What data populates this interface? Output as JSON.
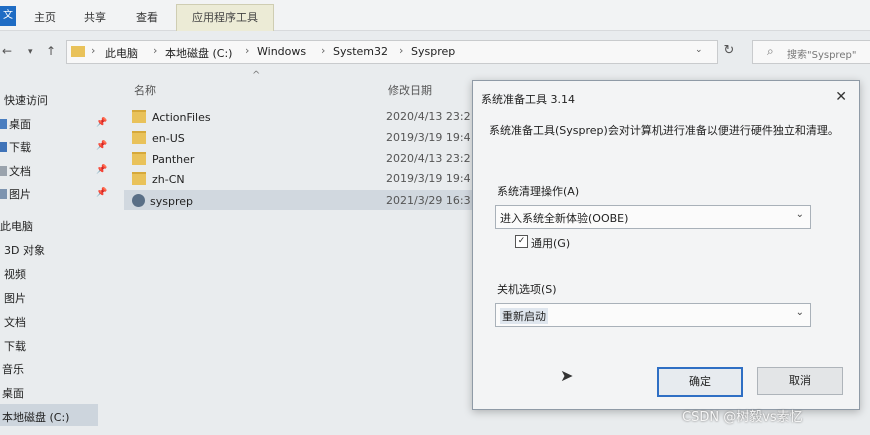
{
  "ribbon": {
    "file_label": "文",
    "tabs": [
      "主页",
      "共享",
      "查看"
    ],
    "context_tab": "应用程序工具"
  },
  "address": {
    "crumbs": [
      "此电脑",
      "本地磁盘 (C:)",
      "Windows",
      "System32",
      "Sysprep"
    ],
    "search_placeholder": "搜索\"Sysprep\""
  },
  "sidebar": {
    "items": [
      "快速访问",
      "桌面",
      "下载",
      "文档",
      "图片",
      "此电脑",
      "3D 对象",
      "视频",
      "图片",
      "文档",
      "下载",
      "音乐",
      "桌面",
      "本地磁盘 (C:)"
    ]
  },
  "columns": {
    "name": "名称",
    "modified": "修改日期"
  },
  "files": [
    {
      "name": "ActionFiles",
      "date": "2020/4/13 23:2",
      "type": "folder"
    },
    {
      "name": "en-US",
      "date": "2019/3/19 19:4",
      "type": "folder"
    },
    {
      "name": "Panther",
      "date": "2020/4/13 23:2",
      "type": "folder"
    },
    {
      "name": "zh-CN",
      "date": "2019/3/19 19:4",
      "type": "folder"
    },
    {
      "name": "sysprep",
      "date": "2021/3/29 16:3",
      "type": "app"
    }
  ],
  "dialog": {
    "title": "系统准备工具 3.14",
    "description": "系统准备工具(Sysprep)会对计算机进行准备以便进行硬件独立和清理。",
    "cleanup_label": "系统清理操作(A)",
    "cleanup_value": "进入系统全新体验(OOBE)",
    "generalize_label": "通用(G)",
    "generalize_checked": true,
    "shutdown_label": "关机选项(S)",
    "shutdown_value": "重新启动",
    "ok_label": "确定",
    "cancel_label": "取消"
  },
  "watermark": "CSDN @树毅vs素忆"
}
